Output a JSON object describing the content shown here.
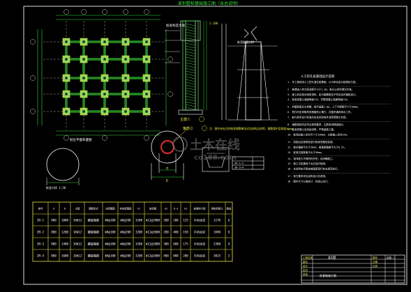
{
  "drawing": {
    "title": "某别墅桩基础施工图（含总说明）",
    "scale_note": "1:100",
    "section_view_label": "桩身构造大样",
    "detail_label": "桩顶锚固大样",
    "circle_label_1": "主筋①",
    "circle_label_2": "箍筋②",
    "dim_d": "d",
    "dim_D": "D",
    "plan_label": "桩位平面布置图",
    "pile_circle_label": "桩身大样 1:20",
    "watermark_cn": "土木在线",
    "watermark_en": "co188.com",
    "note_mid": "注：图中未标注的桩身钢筋做法详见结构总说明，钢筋保护层厚度50mm。",
    "legend_rows": [
      "ZH-1~2",
      "ZH-3~4"
    ]
  },
  "notes": {
    "title": "人工挖孔桩基础设计说明",
    "items": [
      "1. 本工程采用人工挖孔灌注桩基础，以中风化岩为桩端持力层。",
      "2. 桩端进入持力层深度不小于1.0m，桩长以实际情况为准。",
      "3. 施工前应核对地质资料，如与勘察报告不符应及时通知设计。",
      "4. 桩身混凝土强度等级C25，护壁混凝土强度等级C20。",
      "5. 护壁厚度见大样图，每节高度1.0m，上下节搭接不少于50mm。",
      "6. 挖孔时应采取有效措施防止塌方，并做好通风排水工作。",
      "7. 桩孔挖至设计标高后应及时验收并浇筑混凝土封底。",
      "8. 钢筋笼制作应符合规范要求，主筋采用焊接接头。",
      "9. 桩身混凝土应连续浇筑，严禁留施工缝。",
      "10. 桩顶应嵌入承台不少于100mm，主筋锚入承台35d。",
      "11. 成桩后应按规范进行桩身完整性检测。",
      "12. 桩位偏差不大于50mm，垂直度偏差不大于0.5%。",
      "13. 桩底沉渣厚度不大于50mm。",
      "14. 相邻桩孔不得同时开挖，应间隔施工。",
      "15. 施工中如遇地下水应及时抽排。",
      "16. 本说明未尽事宜按国家现行有关规范执行。",
      "17. 其它要求详见结构设计总说明。",
      "18. 图中尺寸以毫米计，标高以米计。"
    ]
  },
  "pile_table": {
    "headers": [
      "桩号",
      "d",
      "D",
      "主筋",
      "箍筋形式",
      "加密箍筋",
      "非加密箍筋",
      "h1",
      "加劲箍",
      "h2",
      "D-d",
      "h3",
      "桩端持力层",
      "单桩承载力",
      "数量"
    ],
    "rows": [
      [
        "ZH-1",
        "800",
        "1000",
        "10Φ12",
        "螺旋箍筋",
        "Φ8@100",
        "Φ8@200",
        "3200",
        "Φ12@2000",
        "200",
        "200",
        "125",
        "中风化岩",
        "1170",
        "6"
      ],
      [
        "ZH-2",
        "800",
        "1200",
        "10Φ12",
        "螺旋箍筋",
        "Φ8@100",
        "Φ8@200",
        "3200",
        "Φ12@2000",
        "200",
        "400",
        "150",
        "中风化岩",
        "1690",
        "6"
      ],
      [
        "ZH-3",
        "800",
        "1400",
        "10Φ12",
        "螺旋箍筋",
        "Φ8@100",
        "Φ8@200",
        "3200",
        "Φ12@2000",
        "300",
        "600",
        "175",
        "中风化岩",
        "2300",
        "4"
      ],
      [
        "ZH-4",
        "800",
        "1600",
        "10Φ12",
        "螺旋箍筋",
        "Φ8@100",
        "Φ8@200",
        "3200",
        "Φ12@2000",
        "400",
        "800",
        "200",
        "中风化岩",
        "3015",
        "2"
      ]
    ]
  },
  "title_block": {
    "project": "某别墅",
    "drawing_name": "桩基础施工图",
    "sheet": "结施-1",
    "labels": [
      "工程名称",
      "图名",
      "设计",
      "校对",
      "审核",
      "图号",
      "日期",
      "比例"
    ]
  }
}
